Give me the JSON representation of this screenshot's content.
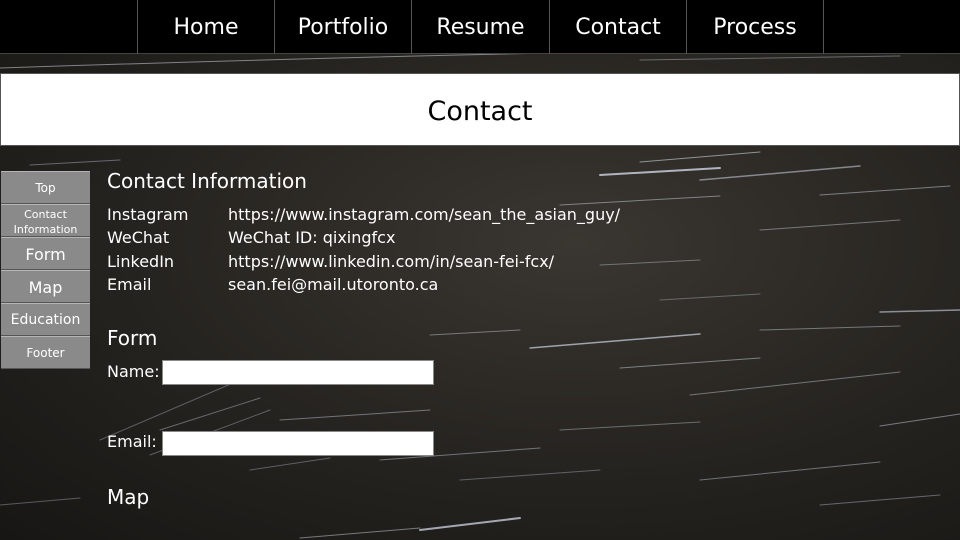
{
  "nav": {
    "items": [
      {
        "label": "Home"
      },
      {
        "label": "Portfolio"
      },
      {
        "label": "Resume"
      },
      {
        "label": "Contact"
      },
      {
        "label": "Process"
      }
    ]
  },
  "page": {
    "title": "Contact"
  },
  "sidebar": {
    "items": [
      {
        "label": "Top"
      },
      {
        "label": "Contact Information"
      },
      {
        "label": "Form"
      },
      {
        "label": "Map"
      },
      {
        "label": "Education"
      },
      {
        "label": "Footer"
      }
    ]
  },
  "contact_info": {
    "heading": "Contact Information",
    "rows": [
      {
        "label": "Instagram",
        "value": "https://www.instagram.com/sean_the_asian_guy/"
      },
      {
        "label": "WeChat",
        "value": "WeChat ID: qixingfcx"
      },
      {
        "label": "LinkedIn",
        "value": "https://www.linkedin.com/in/sean-fei-fcx/"
      },
      {
        "label": "Email",
        "value": "sean.fei@mail.utoronto.ca"
      }
    ]
  },
  "form": {
    "heading": "Form",
    "name_label": "Name:",
    "name_value": "",
    "email_label": "Email:",
    "email_value": ""
  },
  "map": {
    "heading": "Map"
  }
}
